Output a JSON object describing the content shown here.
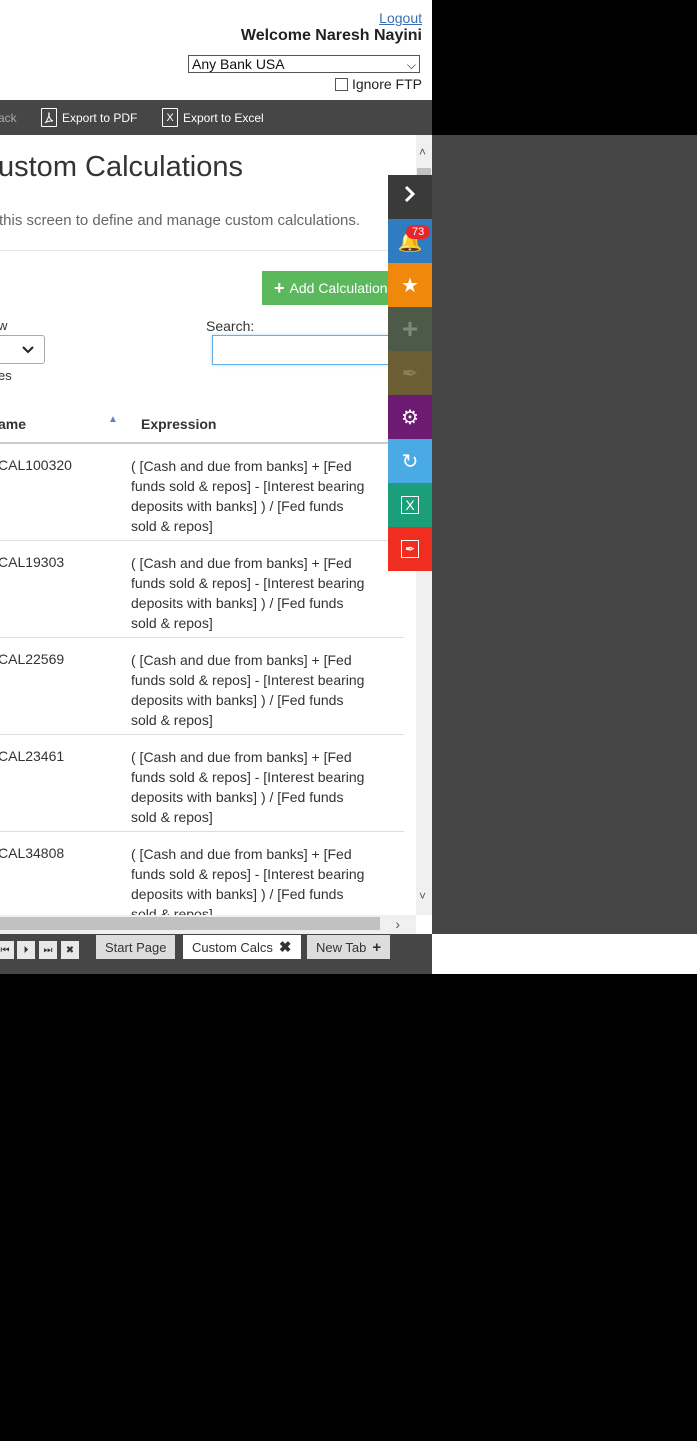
{
  "header": {
    "logout": "Logout",
    "welcome": "Welcome  Naresh Nayini",
    "bank": "Any Bank USA",
    "ignore_ftp": "Ignore FTP"
  },
  "toolbar": {
    "back": "ack",
    "export_pdf": "Export to PDF",
    "export_excel": "Export to Excel"
  },
  "page": {
    "title": "ustom Calculations",
    "intro": "this screen to define and manage custom calculations.",
    "add_button": "Add Calculation",
    "show_label": "w",
    "entries_label": "es",
    "search_label": "Search:",
    "search_value": ""
  },
  "table": {
    "columns": [
      "ame",
      "Expression"
    ],
    "rows": [
      {
        "name": "CAL100320",
        "expression": "( [Cash and due from banks] + [Fed funds sold & repos] - [Interest bearing deposits with banks] ) / [Fed funds sold & repos]"
      },
      {
        "name": "CAL19303",
        "expression": "( [Cash and due from banks] + [Fed funds sold & repos] - [Interest bearing deposits with banks] ) / [Fed funds sold & repos]"
      },
      {
        "name": "CAL22569",
        "expression": "( [Cash and due from banks] + [Fed funds sold & repos] - [Interest bearing deposits with banks] ) / [Fed funds sold & repos]"
      },
      {
        "name": "CAL23461",
        "expression": "( [Cash and due from banks] + [Fed funds sold & repos] - [Interest bearing deposits with banks] ) / [Fed funds sold & repos]"
      },
      {
        "name": "CAL34808",
        "expression": "( [Cash and due from banks] + [Fed funds sold & repos] - [Interest bearing deposits with banks] ) / [Fed funds sold & repos]"
      }
    ]
  },
  "tabs": [
    {
      "label": "Start Page"
    },
    {
      "label": "Custom Calcs"
    },
    {
      "label": "New Tab"
    }
  ],
  "sidepanel": {
    "notifications_count": "73",
    "colors": {
      "collapse": "#3a3a3a",
      "notifications": "#2f7cc1",
      "favorites": "#f0890b",
      "add": "#4d5a48",
      "edit": "#6b5d34",
      "settings": "#6d1a73",
      "refresh": "#4aabe4",
      "excel": "#1a9f7a",
      "pdf": "#ef2e1f"
    }
  },
  "colors": {
    "accent_green": "#5cb85c",
    "toolbar_bg": "#464646"
  }
}
